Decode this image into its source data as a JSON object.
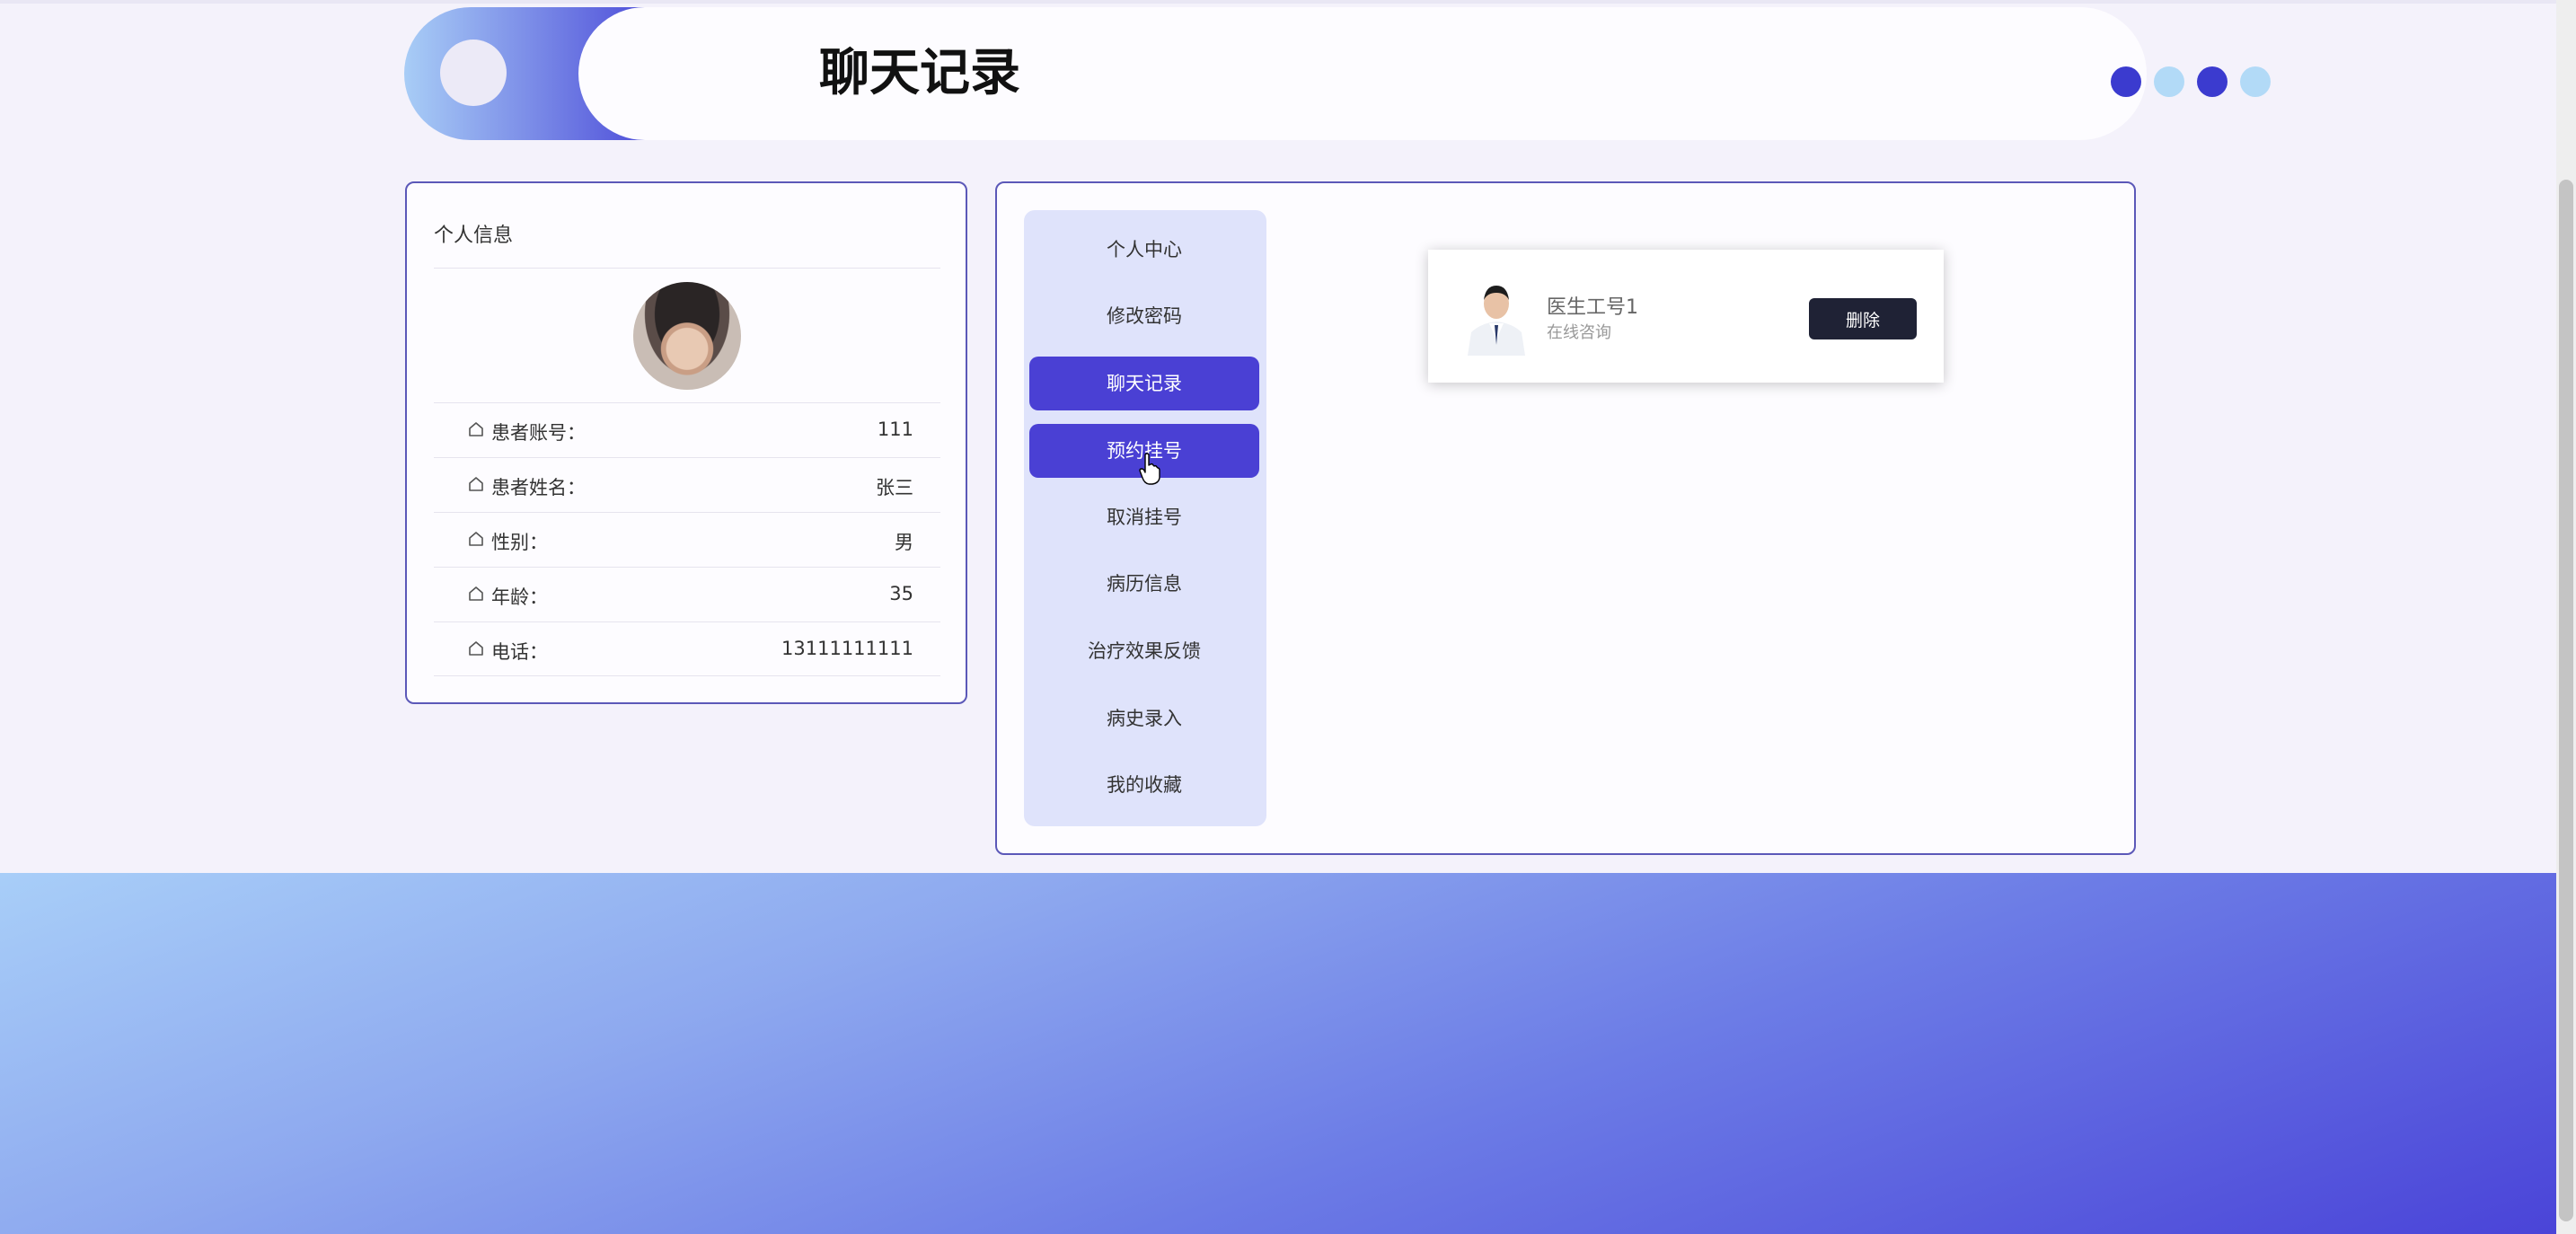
{
  "header": {
    "title": "聊天记录"
  },
  "profile": {
    "title": "个人信息",
    "fields": [
      {
        "label": "患者账号：",
        "value": "111"
      },
      {
        "label": "患者姓名：",
        "value": "张三"
      },
      {
        "label": "性别：",
        "value": "男"
      },
      {
        "label": "年龄：",
        "value": "35"
      },
      {
        "label": "电话：",
        "value": "13111111111"
      }
    ]
  },
  "menu": {
    "items": [
      {
        "label": "个人中心",
        "active": false
      },
      {
        "label": "修改密码",
        "active": false
      },
      {
        "label": "聊天记录",
        "active": true
      },
      {
        "label": "预约挂号",
        "active": true
      },
      {
        "label": "取消挂号",
        "active": false
      },
      {
        "label": "病历信息",
        "active": false
      },
      {
        "label": "治疗效果反馈",
        "active": false
      },
      {
        "label": "病史录入",
        "active": false
      },
      {
        "label": "我的收藏",
        "active": false
      }
    ]
  },
  "chat": {
    "doctor_name": "医生工号1",
    "subtitle": "在线咨询",
    "delete_label": "删除"
  },
  "colors": {
    "accent": "#4a40d4",
    "accent_light": "#b2daf7",
    "menu_bg": "#dfe3fb",
    "border": "#5b58b8",
    "button_dark": "#1f2235"
  }
}
